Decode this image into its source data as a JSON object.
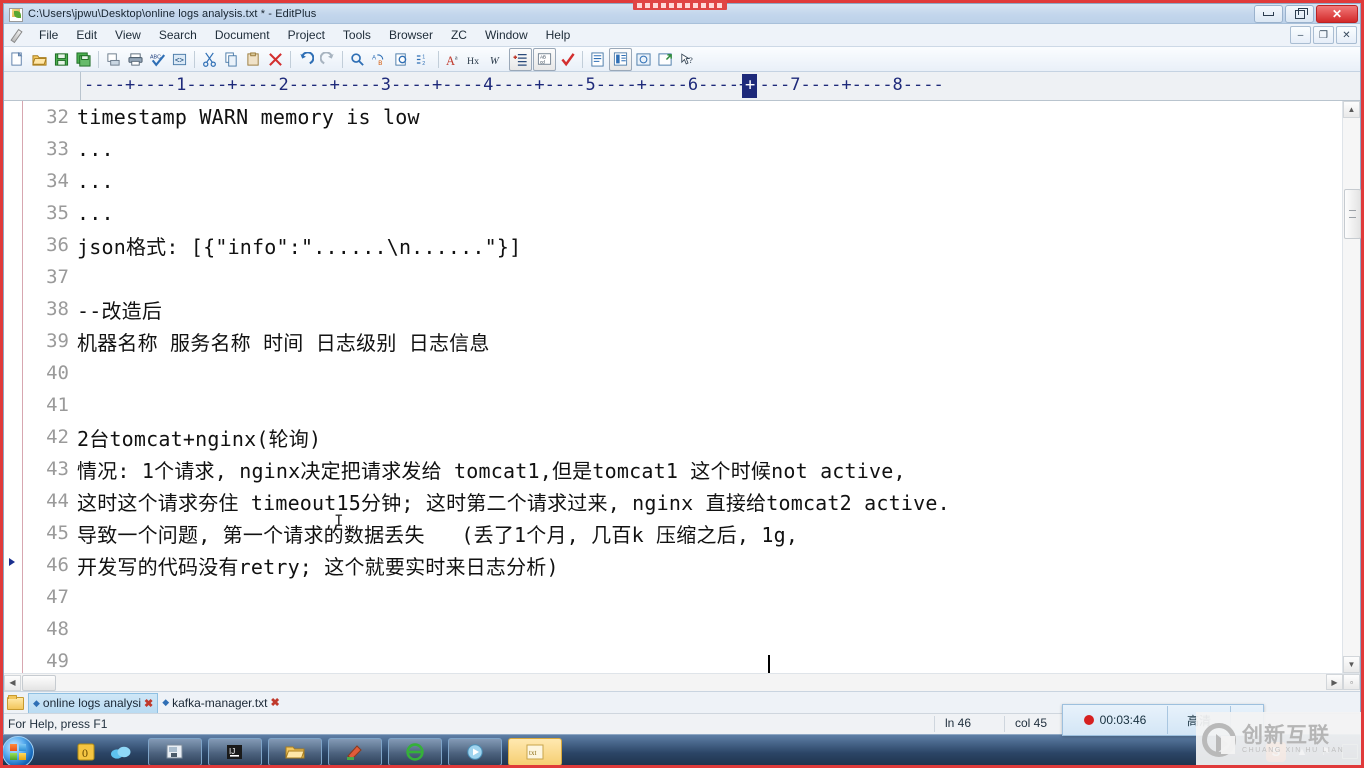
{
  "window": {
    "title": "C:\\Users\\jpwu\\Desktop\\online logs analysis.txt * - EditPlus",
    "app_icon": "editplus-icon",
    "controls": {
      "minimize": "minimize-icon",
      "maximize": "maximize-icon",
      "close": "✕"
    },
    "mdi_controls": {
      "minimize": "–",
      "restore": "❐",
      "close": "✕"
    }
  },
  "menu": {
    "items": [
      "File",
      "Edit",
      "View",
      "Search",
      "Document",
      "Project",
      "Tools",
      "Browser",
      "ZC",
      "Window",
      "Help"
    ]
  },
  "toolbar": {
    "buttons": [
      {
        "name": "new-file-icon",
        "glyph": "Ὄ4"
      },
      {
        "name": "open-file-icon",
        "glyph": "open"
      },
      {
        "name": "save-icon",
        "glyph": "save"
      },
      {
        "name": "save-all-icon",
        "glyph": "save-all"
      },
      {
        "name": "print-preview-icon",
        "glyph": "preview"
      },
      {
        "name": "print-icon",
        "glyph": "print"
      },
      {
        "name": "spell-check-icon",
        "glyph": "abc"
      },
      {
        "name": "html-tag-icon",
        "glyph": "<>"
      },
      {
        "name": "cut-icon",
        "glyph": "scissors"
      },
      {
        "name": "copy-icon",
        "glyph": "copy"
      },
      {
        "name": "paste-icon",
        "glyph": "paste"
      },
      {
        "name": "delete-icon",
        "glyph": "✕"
      },
      {
        "name": "undo-icon",
        "glyph": "↶"
      },
      {
        "name": "redo-icon",
        "glyph": "↷"
      },
      {
        "name": "find-icon",
        "glyph": "ὐD"
      },
      {
        "name": "replace-icon",
        "glyph": "replace"
      },
      {
        "name": "find-in-files-icon",
        "glyph": "files"
      },
      {
        "name": "goto-line-icon",
        "glyph": "goto"
      },
      {
        "name": "font-icon",
        "glyph": "A"
      },
      {
        "name": "hex-viewer-icon",
        "glyph": "Hx"
      },
      {
        "name": "word-wrap-icon",
        "glyph": "W"
      },
      {
        "name": "line-numbers-icon",
        "glyph": "numbers"
      },
      {
        "name": "toggle-case-icon",
        "glyph": "AB"
      },
      {
        "name": "check-icon",
        "glyph": "✓"
      },
      {
        "name": "document-selector-icon",
        "glyph": "doc"
      },
      {
        "name": "clipboard-panel-icon",
        "glyph": "clip"
      },
      {
        "name": "browser-preview-icon",
        "glyph": "browser"
      },
      {
        "name": "user-tools-icon",
        "glyph": "tools"
      },
      {
        "name": "context-help-icon",
        "glyph": "?"
      }
    ]
  },
  "ruler": {
    "scale_text": "----+----1----+----2----+----3----+----4----+----5----+----6----+----7----+----8----",
    "cursor_marker": "+"
  },
  "editor": {
    "first_line_number": 32,
    "lines": [
      {
        "num": "32",
        "text": "timestamp WARN memory is low"
      },
      {
        "num": "33",
        "text": "..."
      },
      {
        "num": "34",
        "text": "..."
      },
      {
        "num": "35",
        "text": "..."
      },
      {
        "num": "36",
        "text": "json格式: [{\"info\":\"......\\n......\"}]"
      },
      {
        "num": "37",
        "text": ""
      },
      {
        "num": "38",
        "text": "--改造后"
      },
      {
        "num": "39",
        "text": "机器名称 服务名称 时间 日志级别 日志信息"
      },
      {
        "num": "40",
        "text": ""
      },
      {
        "num": "41",
        "text": ""
      },
      {
        "num": "42",
        "text": "2台tomcat+nginx(轮询)"
      },
      {
        "num": "43",
        "text": "情况: 1个请求, nginx决定把请求发给 tomcat1,但是tomcat1 这个时候not active,"
      },
      {
        "num": "44",
        "text": "这时这个请求夯住 timeout15分钟; 这时第二个请求过来, nginx 直接给tomcat2 active."
      },
      {
        "num": "45",
        "text": "导致一个问题, 第一个请求的数据丢失   (丢了1个月, 几百k 压缩之后, 1g,"
      },
      {
        "num": "46",
        "text": "开发写的代码没有retry; 这个就要实时来日志分析)"
      },
      {
        "num": "47",
        "text": ""
      },
      {
        "num": "48",
        "text": ""
      },
      {
        "num": "49",
        "text": ""
      }
    ],
    "current_line_marker_row": 46
  },
  "tabs": {
    "folder_icon": "folder-icon",
    "items": [
      {
        "label": "online logs analysi",
        "active": true,
        "close": "✖",
        "marker": "◆"
      },
      {
        "label": "kafka-manager.txt",
        "active": false,
        "close": "✖",
        "marker": "◆"
      }
    ]
  },
  "statusbar": {
    "help_text": "For Help, press F1",
    "line": "ln 46",
    "col": "col 45"
  },
  "recorder": {
    "time": "00:03:46",
    "quality_label": "高清",
    "dot_color": "#d62020"
  },
  "watermark": {
    "cn": "创新互联",
    "en": "CHUANG XIN HU LIAN"
  },
  "taskbar": {
    "start": "start-orb",
    "buttons": [
      {
        "name": "taskbar-item-notes",
        "glyph": "0",
        "highlight": false
      },
      {
        "name": "taskbar-item-cloud",
        "glyph": "☁",
        "highlight": false
      },
      {
        "name": "taskbar-item-vm",
        "glyph": "▣",
        "highlight": false
      },
      {
        "name": "taskbar-item-idea",
        "glyph": "IJ",
        "highlight": false
      },
      {
        "name": "taskbar-item-explorer",
        "glyph": "Ὄ1",
        "highlight": false
      },
      {
        "name": "taskbar-item-paint",
        "glyph": "✎",
        "highlight": false
      },
      {
        "name": "taskbar-item-browser",
        "glyph": "e",
        "highlight": false
      },
      {
        "name": "taskbar-item-media",
        "glyph": "▶",
        "highlight": false
      },
      {
        "name": "taskbar-item-editplus",
        "glyph": "txt",
        "highlight": true
      }
    ],
    "tray": [
      {
        "name": "sogou-input-icon",
        "glyph": "S"
      },
      {
        "name": "show-hidden-icons-icon",
        "glyph": "▲"
      },
      {
        "name": "action-center-flag-icon",
        "glyph": "⚑"
      },
      {
        "name": "network-icon",
        "glyph": "▭"
      }
    ]
  }
}
